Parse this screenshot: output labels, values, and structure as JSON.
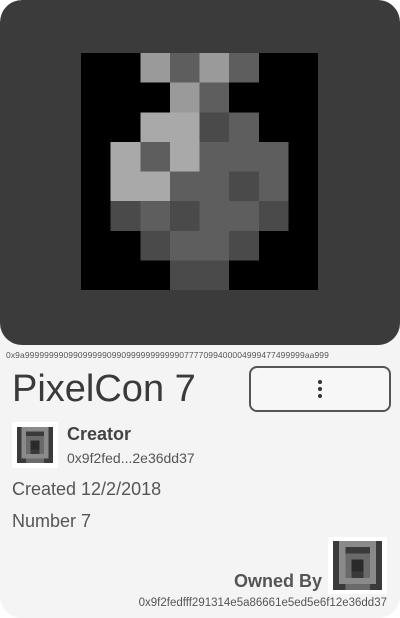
{
  "pixelcon": {
    "hex_id": "0x9a9999999909909999909909999999999907777099400004999477499999aa999",
    "title": "PixelCon 7",
    "art_colors": {
      "black": "#000000",
      "dark_gray": "#4a4a4a",
      "mid_gray": "#5e5e5e",
      "light_gray": "#9a9a9a",
      "pale_gray": "#b0b0b0"
    }
  },
  "menu": {
    "icon": "more-vertical-icon"
  },
  "creator": {
    "label": "Creator",
    "address": "0x9f2fed...2e36dd37",
    "avatar_icon": "pixelcon-avatar-icon"
  },
  "details": {
    "created": "Created 12/2/2018",
    "number": "Number 7"
  },
  "owner": {
    "label": "Owned By",
    "address": "0x9f2fedfff291314e5a86661e5ed5e6f12e36dd37",
    "avatar_icon": "pixelcon-avatar-icon"
  }
}
